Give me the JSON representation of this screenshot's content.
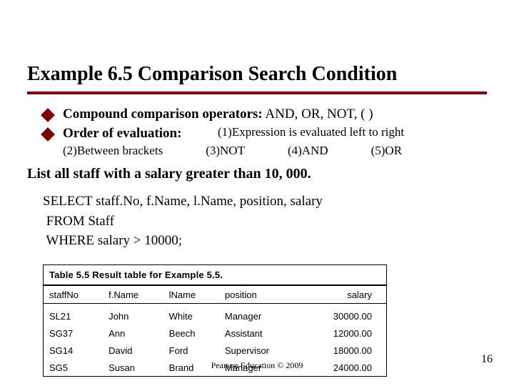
{
  "title": "Example 6.5  Comparison Search Condition",
  "bullets": {
    "b1_label": "Compound comparison operators:",
    "b1_rest": "  AND, OR, NOT, (  )",
    "b2_label": "Order of evaluation:"
  },
  "eval_rules": {
    "r1": "(1)Expression is evaluated left to right",
    "r2": "(2)Between brackets",
    "r3": "(3)NOT",
    "r4": "(4)AND",
    "r5": "(5)OR"
  },
  "prompt": "List all staff with a salary greater than 10, 000.",
  "sql": {
    "l1": "SELECT staff.No, f.Name, l.Name, position, salary",
    "l2": " FROM Staff",
    "l3": " WHERE salary > 10000;"
  },
  "table": {
    "caption_bold": "Table 5.5",
    "caption_rest": "   Result table for Example 5.5.",
    "headers": [
      "staffNo",
      "f.Name",
      "lName",
      "position",
      "salary"
    ],
    "rows": [
      [
        "SL21",
        "John",
        "White",
        "Manager",
        "30000.00"
      ],
      [
        "SG37",
        "Ann",
        "Beech",
        "Assistant",
        "12000.00"
      ],
      [
        "SG14",
        "David",
        "Ford",
        "Supervisor",
        "18000.00"
      ],
      [
        "SG5",
        "Susan",
        "Brand",
        "Manager",
        "24000.00"
      ]
    ]
  },
  "footer": {
    "center": "Pearson Education © 2009",
    "page": "16"
  }
}
